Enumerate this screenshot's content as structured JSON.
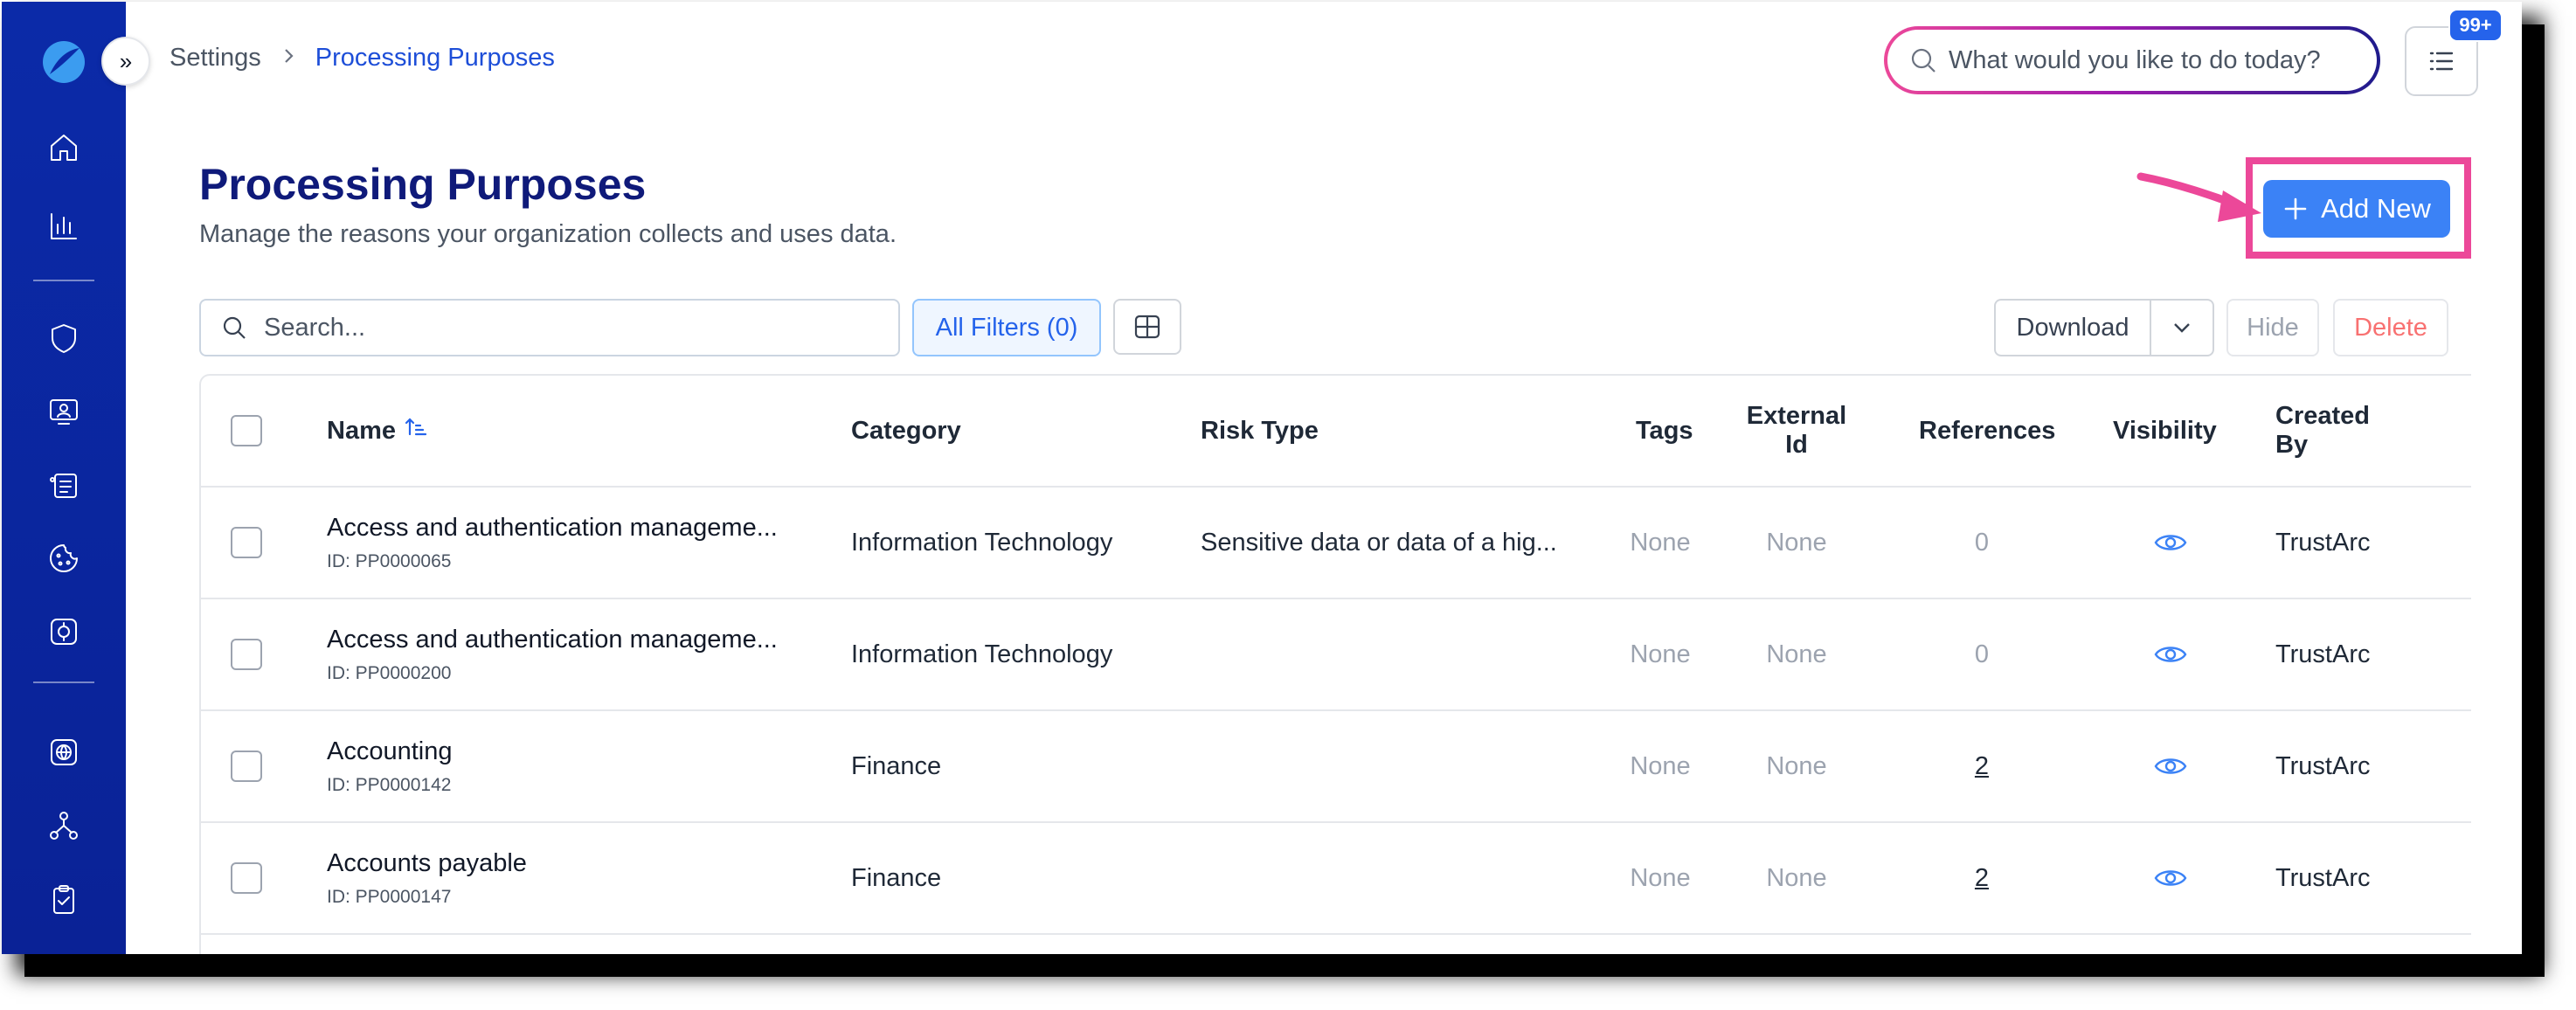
{
  "breadcrumb": {
    "parent": "Settings",
    "current": "Processing Purposes"
  },
  "global_search": {
    "placeholder": "What would you like to do today?"
  },
  "notifications": {
    "badge": "99+"
  },
  "page": {
    "title": "Processing Purposes",
    "subtitle": "Manage the reasons your organization collects and uses data."
  },
  "actions": {
    "add_new": "Add New",
    "download": "Download",
    "hide": "Hide",
    "delete": "Delete"
  },
  "toolbar": {
    "search_placeholder": "Search...",
    "filters_label": "All Filters (0)"
  },
  "table": {
    "columns": {
      "name": "Name",
      "category": "Category",
      "risk_type": "Risk Type",
      "tags": "Tags",
      "external_id_line1": "External",
      "external_id_line2": "Id",
      "references": "References",
      "visibility": "Visibility",
      "created_by_line1": "Created",
      "created_by_line2": "By"
    },
    "rows": [
      {
        "name": "Access and authentication manageme...",
        "id": "ID: PP0000065",
        "category": "Information Technology",
        "risk_type": "Sensitive data or data of a hig...",
        "tags": "None",
        "external_id": "None",
        "references": "0",
        "created_by": "TrustArc"
      },
      {
        "name": "Access and authentication manageme...",
        "id": "ID: PP0000200",
        "category": "Information Technology",
        "risk_type": "",
        "tags": "None",
        "external_id": "None",
        "references": "0",
        "created_by": "TrustArc"
      },
      {
        "name": "Accounting",
        "id": "ID: PP0000142",
        "category": "Finance",
        "risk_type": "",
        "tags": "None",
        "external_id": "None",
        "references": "2",
        "created_by": "TrustArc"
      },
      {
        "name": "Accounts payable",
        "id": "ID: PP0000147",
        "category": "Finance",
        "risk_type": "",
        "tags": "None",
        "external_id": "None",
        "references": "2",
        "created_by": "TrustArc"
      }
    ]
  },
  "sidebar": {
    "icons": [
      "logo-icon",
      "home-icon",
      "analytics-icon",
      "shield-icon",
      "assessment-icon",
      "records-icon",
      "cookie-icon",
      "privacy-icon",
      "globe-icon",
      "network-icon",
      "clipboard-icon"
    ]
  },
  "colors": {
    "sidebar": "#0b2aa8",
    "accent": "#3b82f6",
    "title": "#0f1a7a",
    "highlight": "#ec4899"
  }
}
